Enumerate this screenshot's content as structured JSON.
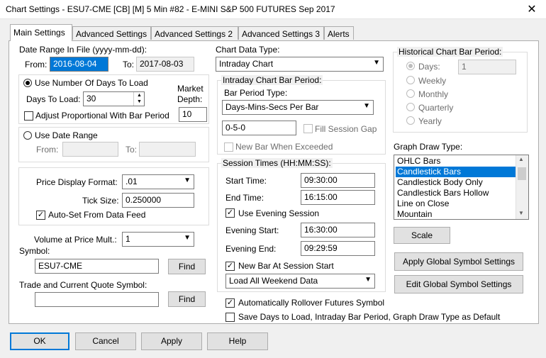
{
  "window": {
    "title": "Chart Settings - ESU7-CME [CB] [M]  5 Min   #82 - E-MINI S&P 500 FUTURES Sep 2017",
    "close_glyph": "✕"
  },
  "tabs": [
    {
      "label": "Main Settings"
    },
    {
      "label": "Advanced Settings"
    },
    {
      "label": "Advanced Settings 2"
    },
    {
      "label": "Advanced Settings 3"
    },
    {
      "label": "Alerts"
    }
  ],
  "date_range": {
    "label": "Date Range In File (yyyy-mm-dd):",
    "from_label": "From:",
    "from_value": "2016-08-04",
    "to_label": "To:",
    "to_value": "2017-08-03"
  },
  "days_group": {
    "radio_label": "Use Number Of Days To Load",
    "days_label": "Days To Load:",
    "days_value": "30",
    "adjust_label": "Adjust Proportional With Bar Period",
    "market_depth_label1": "Market",
    "market_depth_label2": "Depth:",
    "market_depth_value": "10"
  },
  "date_range_group": {
    "radio_label": "Use Date Range",
    "from_label": "From:",
    "to_label": "To:"
  },
  "price_group": {
    "format_label": "Price Display Format:",
    "format_value": ".01",
    "tick_label": "Tick Size:",
    "tick_value": "0.250000",
    "autoset_label": "Auto-Set From Data Feed"
  },
  "volume": {
    "label": "Volume at Price Mult.:",
    "value": "1"
  },
  "symbol": {
    "label": "Symbol:",
    "value": "ESU7-CME",
    "find": "Find"
  },
  "trade_symbol": {
    "label": "Trade and Current Quote Symbol:",
    "value": "",
    "find": "Find"
  },
  "chart_data": {
    "label": "Chart Data Type:",
    "value": "Intraday Chart"
  },
  "intraday": {
    "legend": "Intraday Chart Bar Period:",
    "type_label": "Bar Period Type:",
    "type_value": "Days-Mins-Secs Per Bar",
    "period_value": "0-5-0",
    "fill_gap_label": "Fill Session Gap",
    "new_bar_exceeded_label": "New Bar When Exceeded"
  },
  "session": {
    "legend": "Session Times (HH:MM:SS):",
    "start_label": "Start Time:",
    "start_value": "09:30:00",
    "end_label": "End Time:",
    "end_value": "16:15:00",
    "use_evening_label": "Use Evening Session",
    "evening_start_label": "Evening Start:",
    "evening_start_value": "16:30:00",
    "evening_end_label": "Evening End:",
    "evening_end_value": "09:29:59",
    "new_bar_label": "New Bar At Session Start",
    "weekend_value": "Load All Weekend Data"
  },
  "historical": {
    "legend": "Historical Chart Bar Period:",
    "days_label": "Days:",
    "days_value": "1",
    "weekly": "Weekly",
    "monthly": "Monthly",
    "quarterly": "Quarterly",
    "yearly": "Yearly"
  },
  "graph": {
    "label": "Graph Draw Type:",
    "items": [
      "OHLC Bars",
      "Candlestick Bars",
      "Candlestick Body Only",
      "Candlestick Bars Hollow",
      "Line on Close",
      "Mountain"
    ],
    "selected": "Candlestick Bars"
  },
  "buttons": {
    "scale": "Scale",
    "apply_global": "Apply Global Symbol Settings",
    "edit_global": "Edit Global Symbol Settings",
    "ok": "OK",
    "cancel": "Cancel",
    "apply": "Apply",
    "help": "Help"
  },
  "bottom_options": {
    "auto_rollover": "Automatically Rollover Futures Symbol",
    "save_default": "Save Days to Load, Intraday Bar Period, Graph Draw Type as Default"
  },
  "glyphs": {
    "check": "✓",
    "down": "▼",
    "up_small": "▲",
    "down_small": "▼",
    "scroll_up": "▲",
    "scroll_down": "▼"
  }
}
